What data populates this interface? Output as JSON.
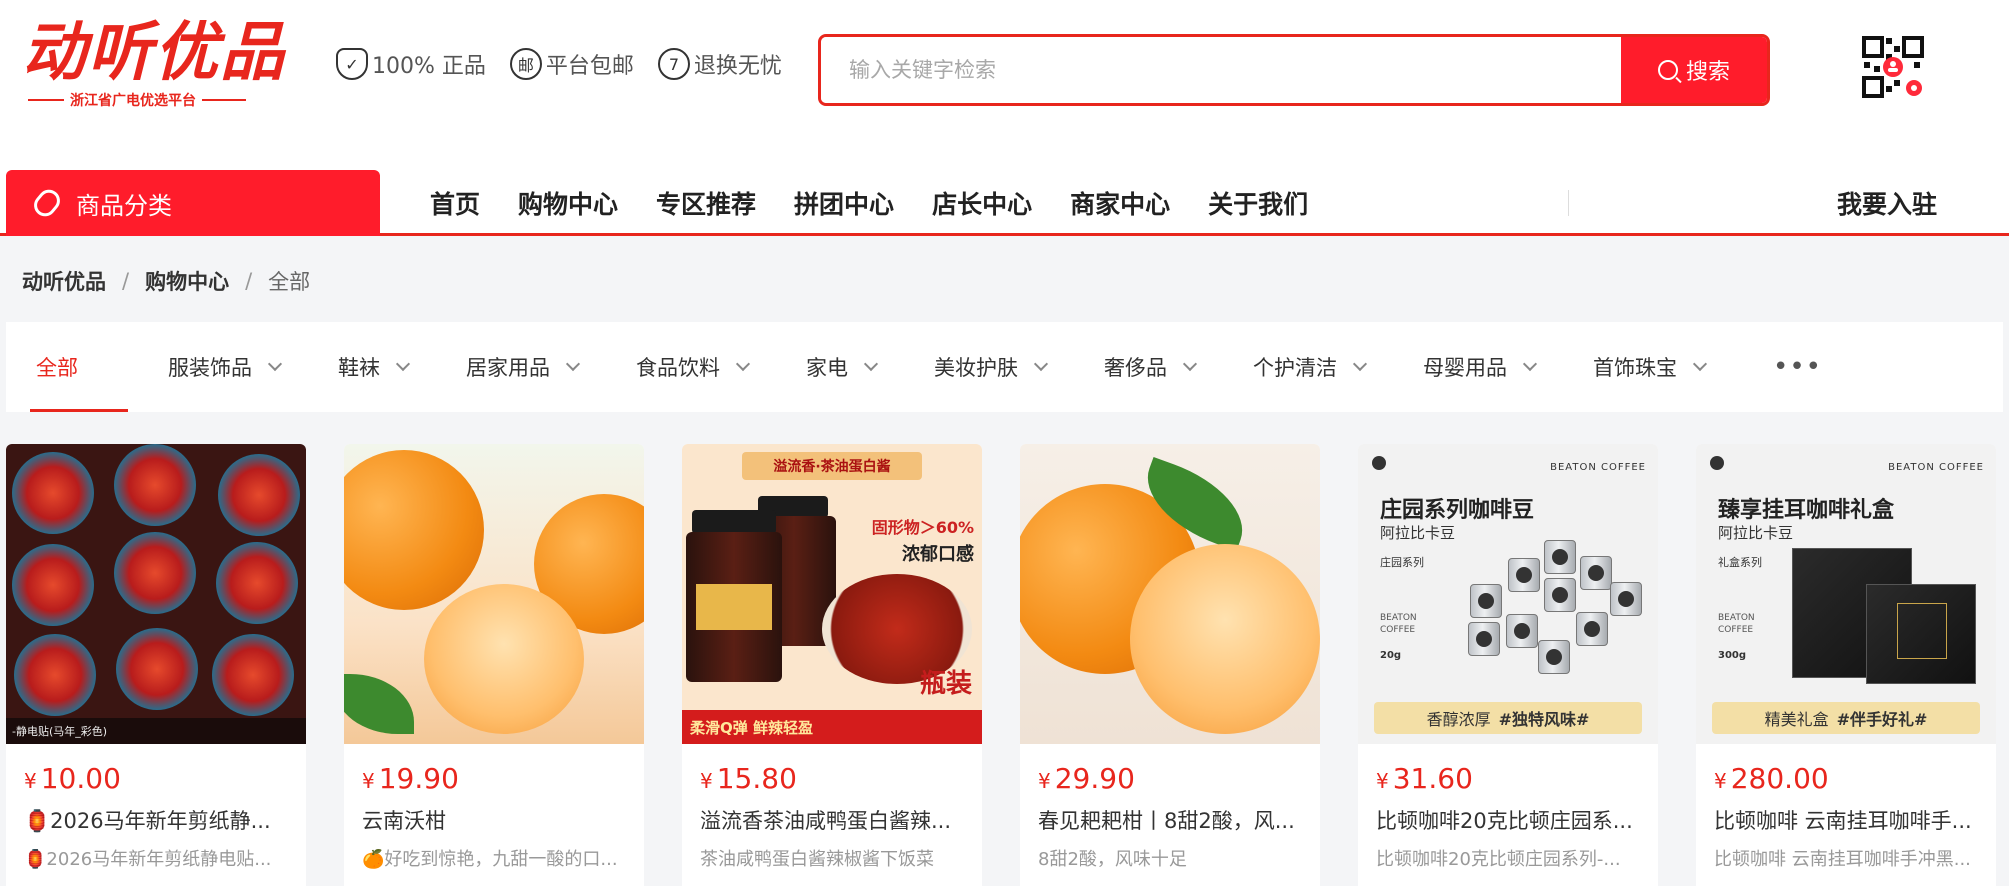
{
  "header": {
    "logo_text": "动听优品",
    "logo_sub": "浙江省广电优选平台",
    "promises": [
      {
        "icon": "shield-check-icon",
        "label": "100% 正品"
      },
      {
        "icon": "mail-icon",
        "glyph": "邮",
        "label": "平台包邮"
      },
      {
        "icon": "seven-days-icon",
        "glyph": "7",
        "label": "退换无忧"
      }
    ],
    "search": {
      "placeholder": "输入关键字检索",
      "button_label": "搜索"
    }
  },
  "nav": {
    "category_label": "商品分类",
    "links": [
      "首页",
      "购物中心",
      "专区推荐",
      "拼团中心",
      "店长中心",
      "商家中心",
      "关于我们"
    ],
    "join_label": "我要入驻"
  },
  "breadcrumb": {
    "items": [
      "动听优品",
      "购物中心"
    ],
    "current": "全部",
    "separator": "/"
  },
  "filters": {
    "items": [
      "全部",
      "服装饰品",
      "鞋袜",
      "居家用品",
      "食品饮料",
      "家电",
      "美妆护肤",
      "奢侈品",
      "个护清洁",
      "母婴用品",
      "首饰珠宝"
    ],
    "active_index": 0,
    "more": "•••"
  },
  "products": [
    {
      "currency": "¥",
      "price": "10.00",
      "title": "🏮2026马年新年剪纸静...",
      "subtitle": "🏮2026马年新年剪纸静电贴...",
      "thumb_caption": "-静电贴(马年_彩色)"
    },
    {
      "currency": "¥",
      "price": "19.90",
      "title": "云南沃柑",
      "subtitle": "🍊好吃到惊艳，九甜一酸的口..."
    },
    {
      "currency": "¥",
      "price": "15.80",
      "title": "溢流香茶油咸鸭蛋白酱辣...",
      "subtitle": "茶油咸鸭蛋白酱辣椒酱下饭菜",
      "thumb_banner": "溢流香·茶油蛋白酱",
      "thumb_tag1": "固形物＞60%",
      "thumb_tag2": "浓郁口感",
      "thumb_bottom": "柔滑Q弹 鲜辣轻盈",
      "thumb_badge": "瓶装"
    },
    {
      "currency": "¥",
      "price": "29.90",
      "title": "春见耙耙柑丨8甜2酸，风...",
      "subtitle": "8甜2酸，风味十足"
    },
    {
      "currency": "¥",
      "price": "31.60",
      "title": "比顿咖啡20克比顿庄园系...",
      "subtitle": "比顿咖啡20克比顿庄园系列-...",
      "thumb_title": "庄园系列咖啡豆",
      "thumb_sub": "阿拉比卡豆",
      "thumb_series": "庄园系列",
      "thumb_weight": "20g",
      "thumb_foot_a": "香醇浓厚",
      "thumb_foot_b": "#独特风味#",
      "thumb_brand": "BEATON COFFEE"
    },
    {
      "currency": "¥",
      "price": "280.00",
      "title": "比顿咖啡 云南挂耳咖啡手...",
      "subtitle": "比顿咖啡 云南挂耳咖啡手冲黑...",
      "thumb_title": "臻享挂耳咖啡礼盒",
      "thumb_sub": "阿拉比卡豆",
      "thumb_series": "礼盒系列",
      "thumb_weight": "300g",
      "thumb_foot_a": "精美礼盒",
      "thumb_foot_b": "#伴手好礼#",
      "thumb_brand": "BEATON COFFEE"
    }
  ],
  "colors": {
    "accent": "#e8261d",
    "button": "#ff1c2b",
    "price": "#e8261d"
  }
}
